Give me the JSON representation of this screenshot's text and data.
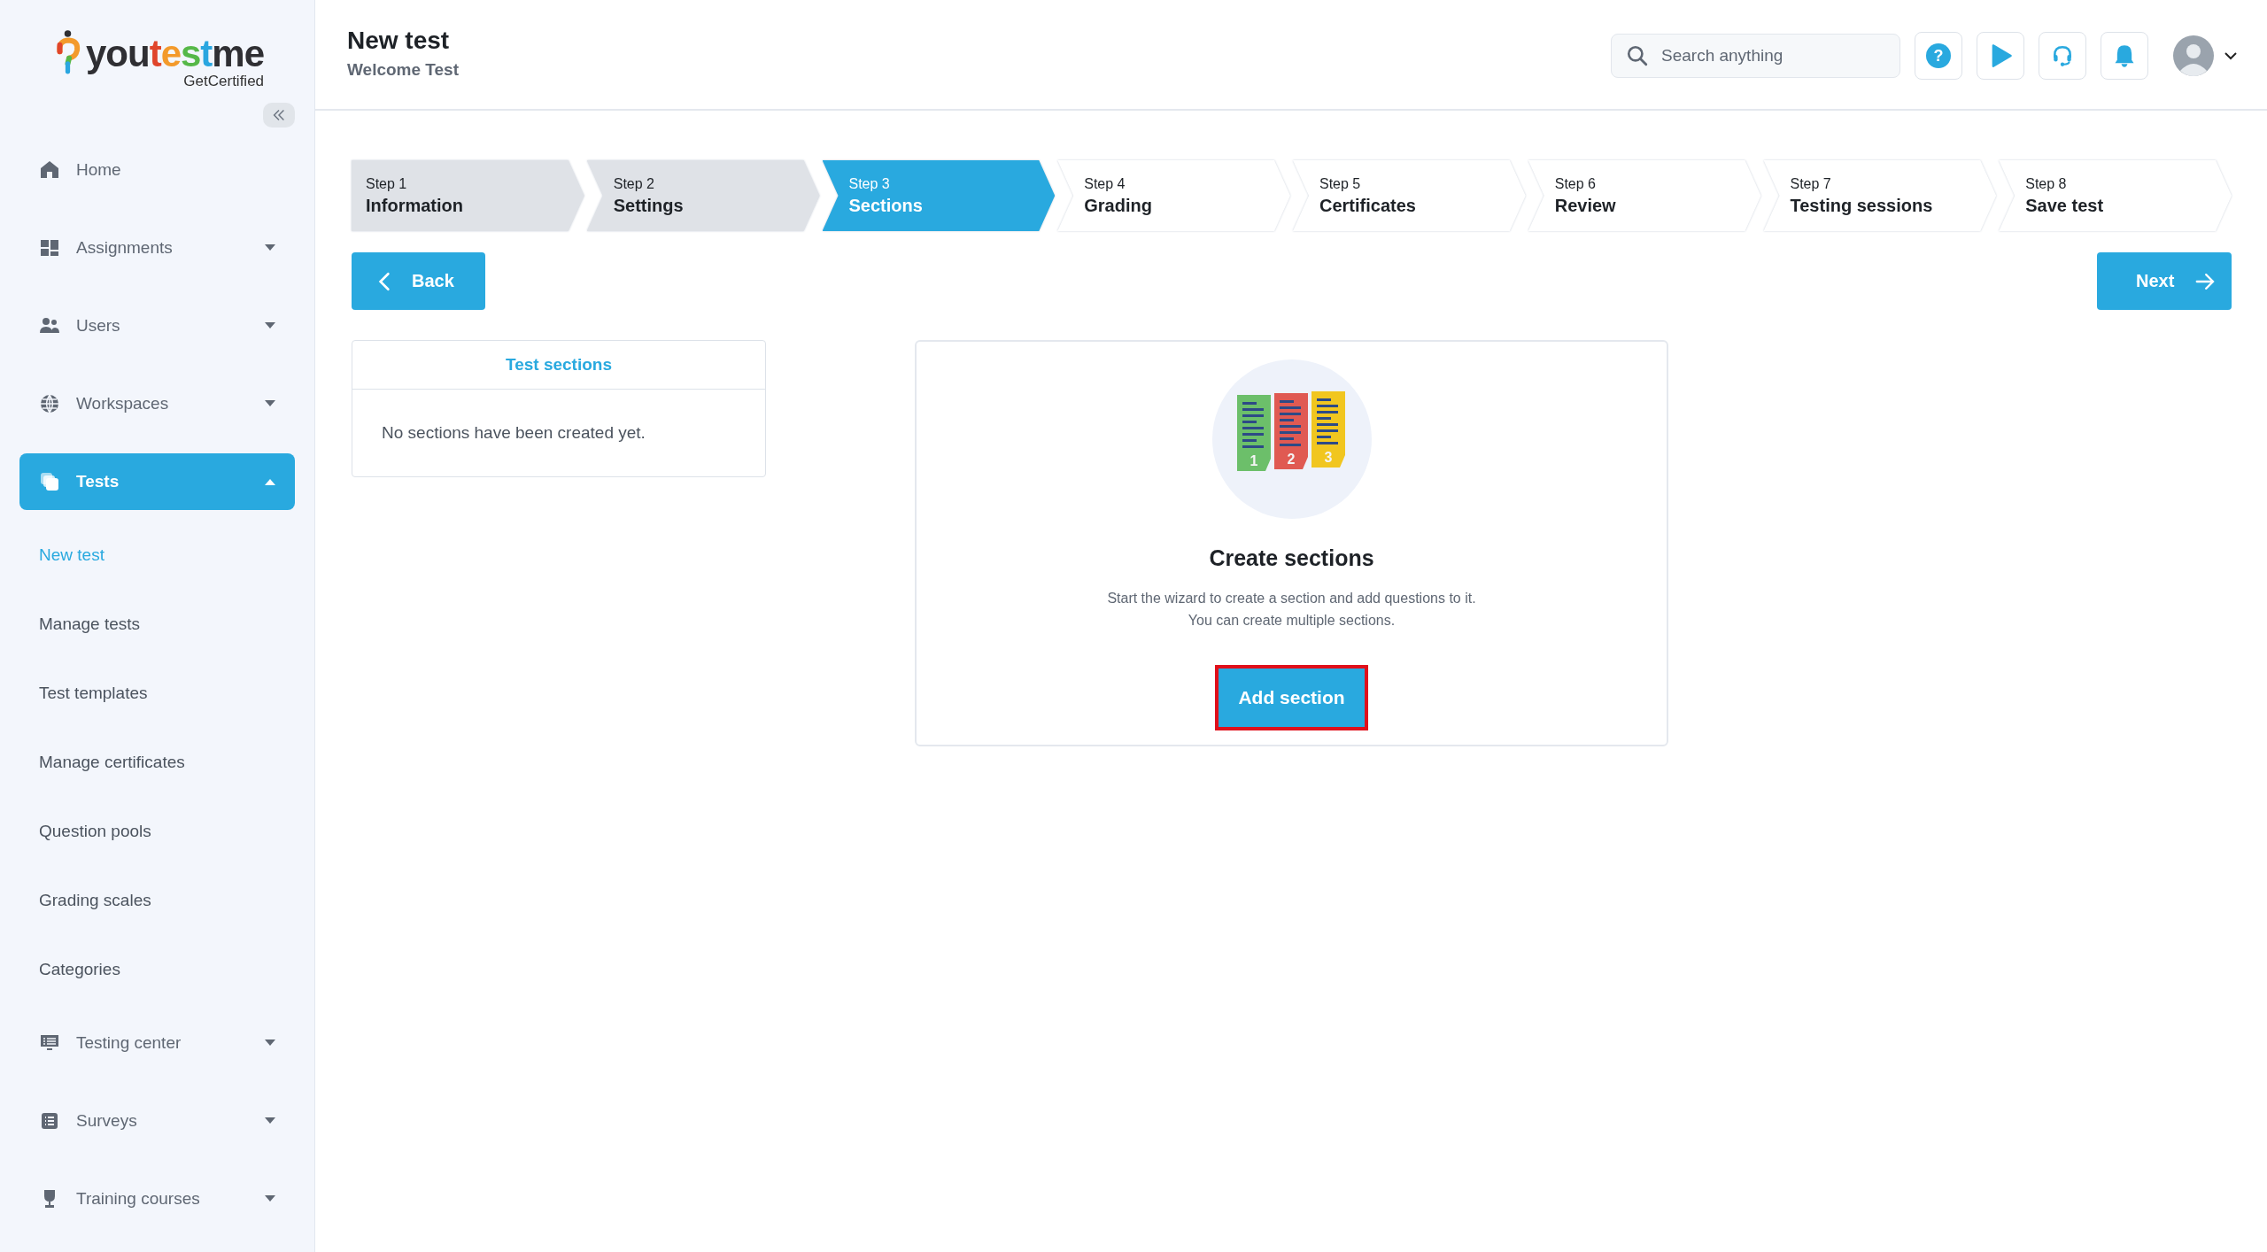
{
  "logo": {
    "parts": [
      {
        "text": "you",
        "color": "#2f2f33"
      },
      {
        "text": "t",
        "color": "#e0452b"
      },
      {
        "text": "e",
        "color": "#f39a2b"
      },
      {
        "text": "s",
        "color": "#56b848"
      },
      {
        "text": "t",
        "color": "#2aa6e0"
      },
      {
        "text": "me",
        "color": "#2f2f33"
      }
    ],
    "tagline": "GetCertified"
  },
  "sidebar": {
    "items": [
      {
        "label": "Home",
        "kind": "link",
        "selected": false
      },
      {
        "label": "Assignments",
        "kind": "group",
        "expanded": false,
        "selected": false
      },
      {
        "label": "Users",
        "kind": "group",
        "expanded": false,
        "selected": false
      },
      {
        "label": "Workspaces",
        "kind": "group",
        "expanded": false,
        "selected": false
      },
      {
        "label": "Tests",
        "kind": "group",
        "expanded": true,
        "selected": true,
        "children": [
          {
            "label": "New test",
            "selected": true
          },
          {
            "label": "Manage tests",
            "selected": false
          },
          {
            "label": "Test templates",
            "selected": false
          },
          {
            "label": "Manage certificates",
            "selected": false
          },
          {
            "label": "Question pools",
            "selected": false
          },
          {
            "label": "Grading scales",
            "selected": false
          },
          {
            "label": "Categories",
            "selected": false
          }
        ]
      },
      {
        "label": "Testing center",
        "kind": "group",
        "expanded": false,
        "selected": false
      },
      {
        "label": "Surveys",
        "kind": "group",
        "expanded": false,
        "selected": false
      },
      {
        "label": "Training courses",
        "kind": "group",
        "expanded": false,
        "selected": false
      }
    ]
  },
  "header": {
    "title": "New test",
    "subtitle": "Welcome Test",
    "search": {
      "placeholder": "Search anything"
    },
    "help_icon": "?"
  },
  "steps": [
    {
      "label": "Step 1",
      "name": "Information",
      "completed": true,
      "selected": false
    },
    {
      "label": "Step 2",
      "name": "Settings",
      "completed": true,
      "selected": false
    },
    {
      "label": "Step 3",
      "name": "Sections",
      "completed": false,
      "selected": true
    },
    {
      "label": "Step 4",
      "name": "Grading",
      "completed": false,
      "selected": false
    },
    {
      "label": "Step 5",
      "name": "Certificates",
      "completed": false,
      "selected": false
    },
    {
      "label": "Step 6",
      "name": "Review",
      "completed": false,
      "selected": false
    },
    {
      "label": "Step 7",
      "name": "Testing sessions",
      "completed": false,
      "selected": false
    },
    {
      "label": "Step 8",
      "name": "Save test",
      "completed": false,
      "selected": false
    }
  ],
  "back_button": "Back",
  "next_button": "Next",
  "sections_panel": {
    "title": "Test sections",
    "empty_text": "No sections have been created yet."
  },
  "empty_state": {
    "folders": [
      {
        "label": "1",
        "color": "#6cbf6a"
      },
      {
        "label": "2",
        "color": "#e05a52"
      },
      {
        "label": "3",
        "color": "#f1c61f"
      }
    ],
    "title": "Create sections",
    "lines": [
      "Start the wizard to create a section and add questions to it.",
      "You can create multiple sections."
    ],
    "button": {
      "label": "Add section",
      "highlighted": true
    }
  }
}
